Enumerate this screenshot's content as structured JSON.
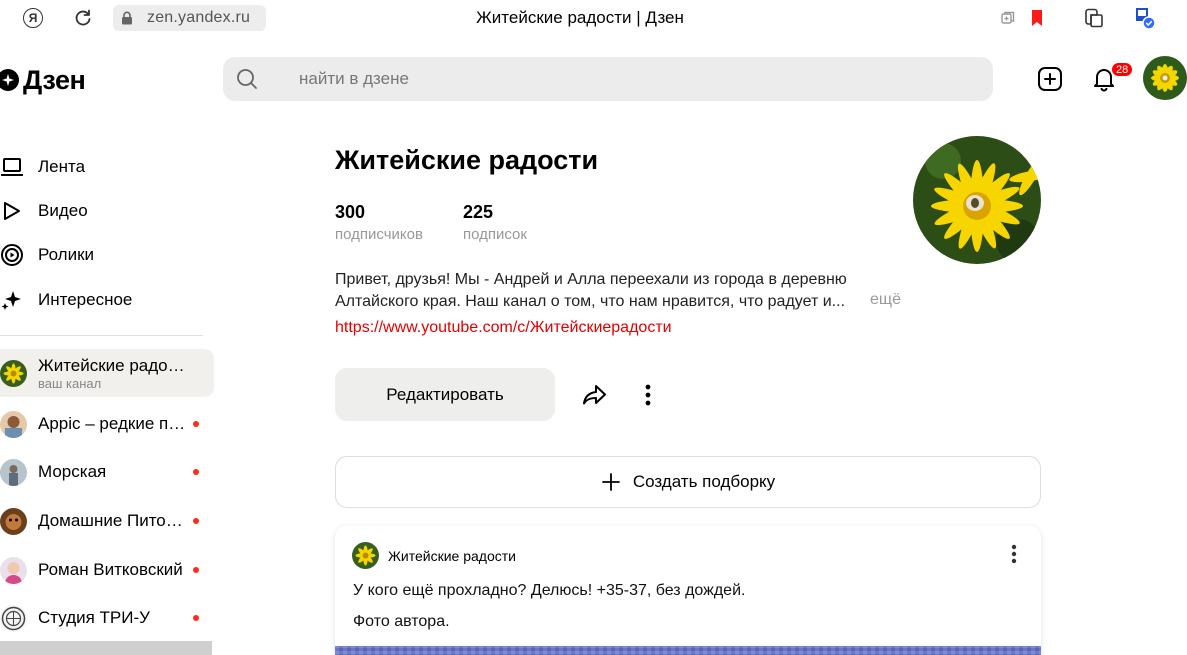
{
  "browser": {
    "ya_letter": "Я",
    "url": "zen.yandex.ru",
    "tab_title": "Житейские радости | Дзен"
  },
  "header": {
    "logo_text": "Дзен",
    "search_placeholder": "найти в дзене",
    "notifications_count": "28"
  },
  "sidebar": {
    "nav": [
      {
        "label": "Лента",
        "icon": "laptop-icon"
      },
      {
        "label": "Видео",
        "icon": "play-icon"
      },
      {
        "label": "Ролики",
        "icon": "shorts-icon"
      },
      {
        "label": "Интересное",
        "icon": "sparkle-icon"
      }
    ],
    "channels": [
      {
        "name": "Житейские радости",
        "sub": "ваш канал",
        "active": true
      },
      {
        "name": "Appic – редкие приложения",
        "unread": true
      },
      {
        "name": "Морская",
        "unread": true
      },
      {
        "name": "Домашние Питомцы",
        "unread": true
      },
      {
        "name": "Роман Витковский",
        "unread": true
      },
      {
        "name": "Студия ТРИ-У",
        "unread": true
      }
    ]
  },
  "profile": {
    "title": "Житейские радости",
    "subscribers_count": "300",
    "subscribers_label": "подписчиков",
    "subscriptions_count": "225",
    "subscriptions_label": "подписок",
    "description": "Привет, друзья! Мы - Андрей и Алла переехали из города в деревню Алтайского края. Наш канал о том, что нам нравится, что радует и...",
    "more_label": "ещё",
    "link": "https://www.youtube.com/c/Житейскиерадости",
    "edit_label": "Редактировать",
    "create_collection_label": "Создать подборку"
  },
  "post": {
    "author": "Житейские радости",
    "line1": "У кого ещё прохладно? Делюсь! +35-37, без дождей.",
    "line2": "Фото автора."
  },
  "colors": {
    "accent_red": "#ff0000",
    "link_red": "#e60000",
    "unread_dot": "#ff2a1a"
  }
}
